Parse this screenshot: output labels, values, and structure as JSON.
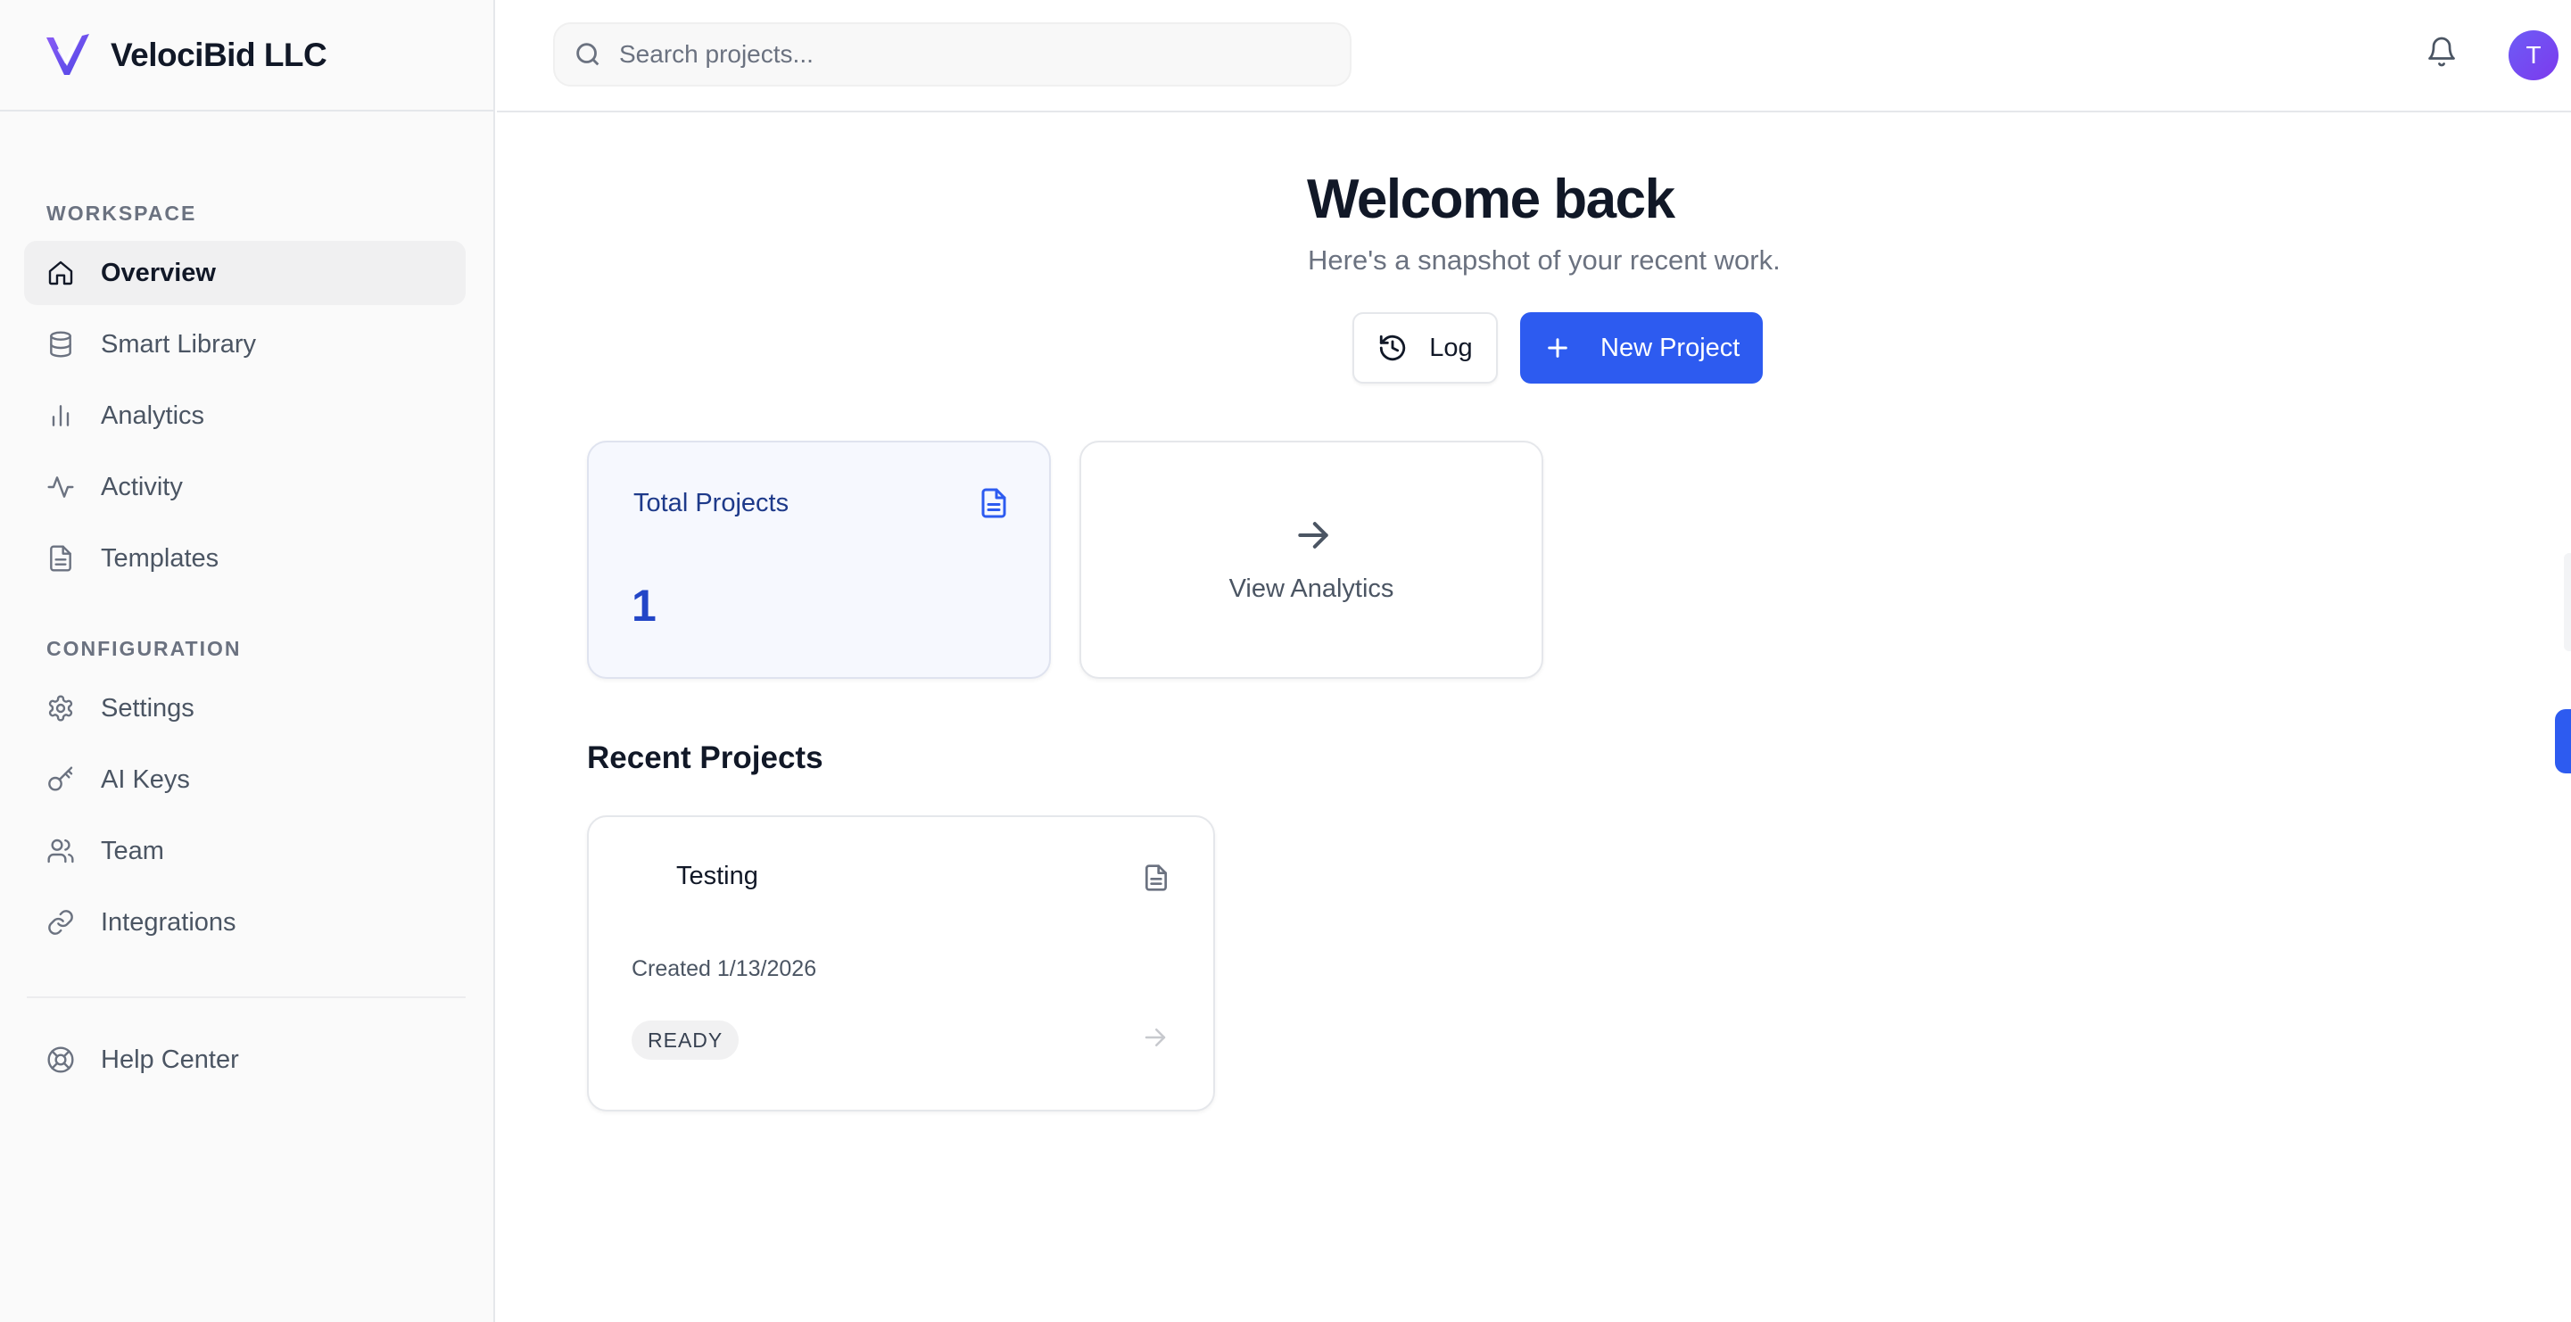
{
  "brand": {
    "name": "VelociBid LLC",
    "logo_icon": "v-check-logo-icon"
  },
  "colors": {
    "accent": "#2d5bf0",
    "accent_dark": "#2346c7",
    "logo_purple": "#7c3aed",
    "avatar": "#6d5cf6"
  },
  "sidebar": {
    "workspace_heading": "WORKSPACE",
    "workspace_items": [
      {
        "label": "Overview",
        "icon": "home-icon",
        "active": true
      },
      {
        "label": "Smart Library",
        "icon": "database-icon"
      },
      {
        "label": "Analytics",
        "icon": "bar-chart-icon"
      },
      {
        "label": "Activity",
        "icon": "activity-icon"
      },
      {
        "label": "Templates",
        "icon": "file-text-icon"
      }
    ],
    "configuration_heading": "CONFIGURATION",
    "configuration_items": [
      {
        "label": "Settings",
        "icon": "gear-icon"
      },
      {
        "label": "AI Keys",
        "icon": "key-icon"
      },
      {
        "label": "Team",
        "icon": "users-icon"
      },
      {
        "label": "Integrations",
        "icon": "link-icon"
      }
    ],
    "help_item": {
      "label": "Help Center",
      "icon": "life-buoy-icon"
    }
  },
  "topbar": {
    "search": {
      "placeholder": "Search projects...",
      "value": "",
      "icon": "search-icon"
    },
    "notifications_icon": "bell-icon",
    "avatar_initial": "T"
  },
  "main": {
    "title": "Welcome back",
    "subtitle": "Here's a snapshot of your recent work.",
    "log_button": {
      "label": "Log",
      "icon": "history-icon"
    },
    "new_project_button": {
      "label": "New Project",
      "icon": "plus-icon"
    },
    "stats": {
      "total_projects": {
        "label": "Total Projects",
        "value": "1",
        "icon": "file-text-icon"
      },
      "view_analytics": {
        "label": "View Analytics",
        "icon": "arrow-right-icon"
      }
    },
    "recent_projects_heading": "Recent Projects",
    "recent_projects": [
      {
        "name": "Testing",
        "created": "Created 1/13/2026",
        "status": "READY",
        "icon": "file-text-icon"
      }
    ]
  }
}
